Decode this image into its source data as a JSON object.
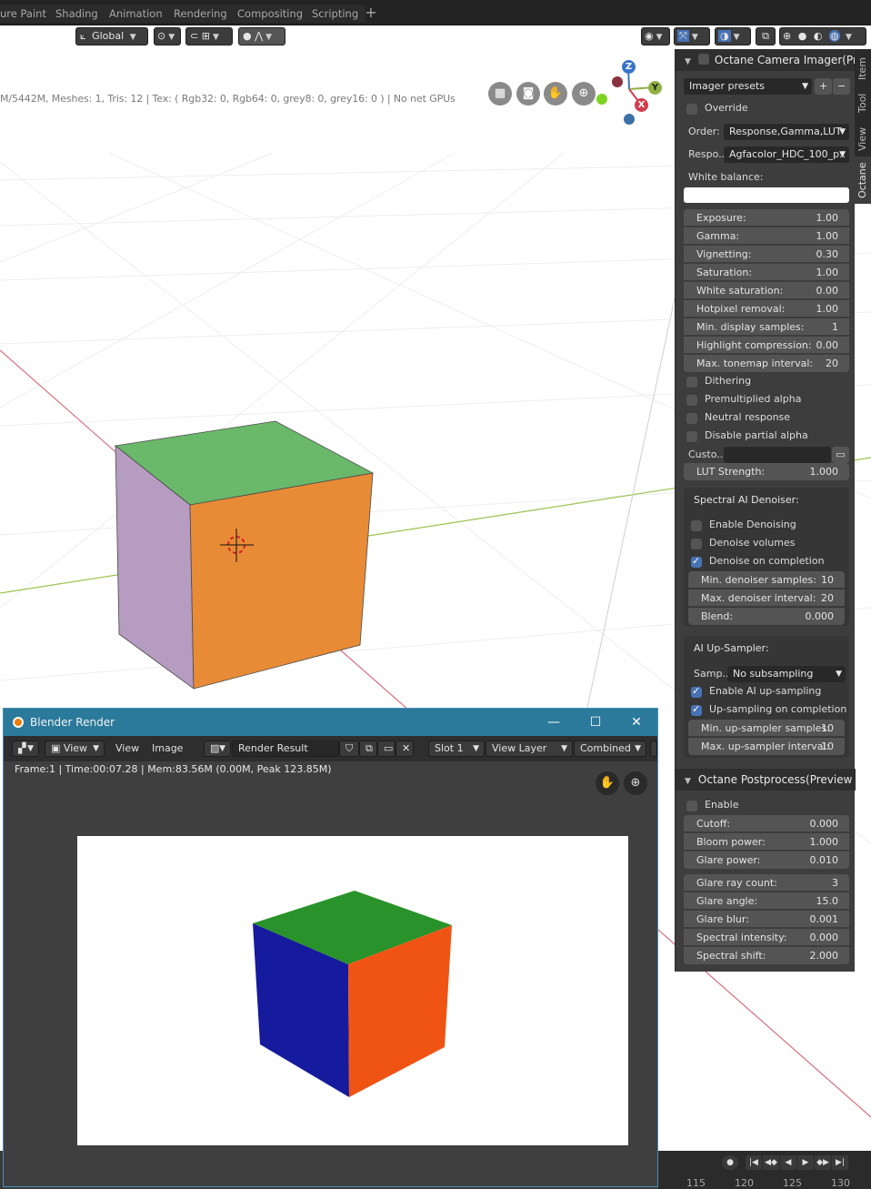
{
  "workspace_tabs": [
    "ure Paint",
    "Shading",
    "Animation",
    "Rendering",
    "Compositing",
    "Scripting"
  ],
  "add_tab_label": "+",
  "viewport": {
    "orientation": "Global",
    "stats": "M/5442M, Meshes: 1, Tris: 12 | Tex: ( Rgb32: 0, Rgb64: 0, grey8: 0, grey16: 0 ) | No net GPUs",
    "gizmo": {
      "z": "Z",
      "y": "Y",
      "x": "X"
    },
    "colors": {
      "cube_top": "#6ab86a",
      "cube_left": "#b59cc0",
      "cube_front": "#e88b37",
      "axis_x": "#d4707e",
      "axis_y": "#9cc24e"
    }
  },
  "camera_imager": {
    "title": "Octane Camera Imager(Prev",
    "presets_label": "Imager presets",
    "preset_add": "+",
    "preset_remove": "−",
    "override_label": "Override",
    "order_label": "Order:",
    "order_value": "Response,Gamma,LUT",
    "response_label": "Respo..",
    "response_value": "Agfacolor_HDC_100_p..",
    "white_balance_label": "White balance:",
    "fields": [
      {
        "label": "Exposure:",
        "value": "1.00"
      },
      {
        "label": "Gamma:",
        "value": "1.00"
      },
      {
        "label": "Vignetting:",
        "value": "0.30"
      },
      {
        "label": "Saturation:",
        "value": "1.00"
      },
      {
        "label": "White saturation:",
        "value": "0.00"
      },
      {
        "label": "Hotpixel removal:",
        "value": "1.00"
      },
      {
        "label": "Min. display samples:",
        "value": "1"
      },
      {
        "label": "Highlight compression:",
        "value": "0.00"
      },
      {
        "label": "Max. tonemap interval:",
        "value": "20"
      }
    ],
    "checkboxes": [
      {
        "label": "Dithering",
        "checked": false
      },
      {
        "label": "Premultiplied alpha",
        "checked": false
      },
      {
        "label": "Neutral response",
        "checked": false
      },
      {
        "label": "Disable partial alpha",
        "checked": false
      }
    ],
    "custom_lut_label": "Custo..",
    "lut_strength_label": "LUT Strength:",
    "lut_strength_value": "1.000",
    "denoiser": {
      "title": "Spectral AI Denoiser:",
      "checkboxes": [
        {
          "label": "Enable Denoising",
          "checked": false
        },
        {
          "label": "Denoise volumes",
          "checked": false
        },
        {
          "label": "Denoise on completion",
          "checked": true
        }
      ],
      "fields": [
        {
          "label": "Min. denoiser samples:",
          "value": "10"
        },
        {
          "label": "Max. denoiser interval:",
          "value": "20"
        },
        {
          "label": "Blend:",
          "value": "0.000"
        }
      ]
    },
    "upsampler": {
      "title": "AI Up-Sampler:",
      "samp_label": "Samp..",
      "samp_value": "No subsampling",
      "checkboxes": [
        {
          "label": "Enable AI up-sampling",
          "checked": true
        },
        {
          "label": "Up-sampling on completion",
          "checked": true
        }
      ],
      "fields": [
        {
          "label": "Min. up-sampler samples:",
          "value": "10"
        },
        {
          "label": "Max. up-sampler interval:",
          "value": "10"
        }
      ]
    }
  },
  "postprocess": {
    "title": "Octane Postprocess(Preview Mo",
    "enable_label": "Enable",
    "enable_checked": false,
    "fields_a": [
      {
        "label": "Cutoff:",
        "value": "0.000"
      },
      {
        "label": "Bloom power:",
        "value": "1.000"
      },
      {
        "label": "Glare power:",
        "value": "0.010"
      }
    ],
    "fields_b": [
      {
        "label": "Glare ray count:",
        "value": "3"
      },
      {
        "label": "Glare angle:",
        "value": "15.0"
      },
      {
        "label": "Glare blur:",
        "value": "0.001"
      },
      {
        "label": "Spectral intensity:",
        "value": "0.000"
      },
      {
        "label": "Spectral shift:",
        "value": "2.000"
      }
    ]
  },
  "vertical_tabs": [
    "Item",
    "Tool",
    "View",
    "Octane"
  ],
  "render_window": {
    "title": "Blender Render",
    "minimize": "—",
    "maximize": "☐",
    "close": "✕",
    "menu": [
      "View",
      "View",
      "Image"
    ],
    "image_name": "Render Result",
    "slot": "Slot 1",
    "view_layer": "View Layer",
    "pass": "Combined",
    "info": "Frame:1 | Time:00:07.28 | Mem:83.56M (0.00M, Peak 123.85M)",
    "colors": {
      "cube_top": "#2a922a",
      "cube_left": "#161a9c",
      "cube_front": "#f05414"
    }
  },
  "timeline": {
    "numbers": [
      "115",
      "120",
      "125",
      "130"
    ]
  }
}
